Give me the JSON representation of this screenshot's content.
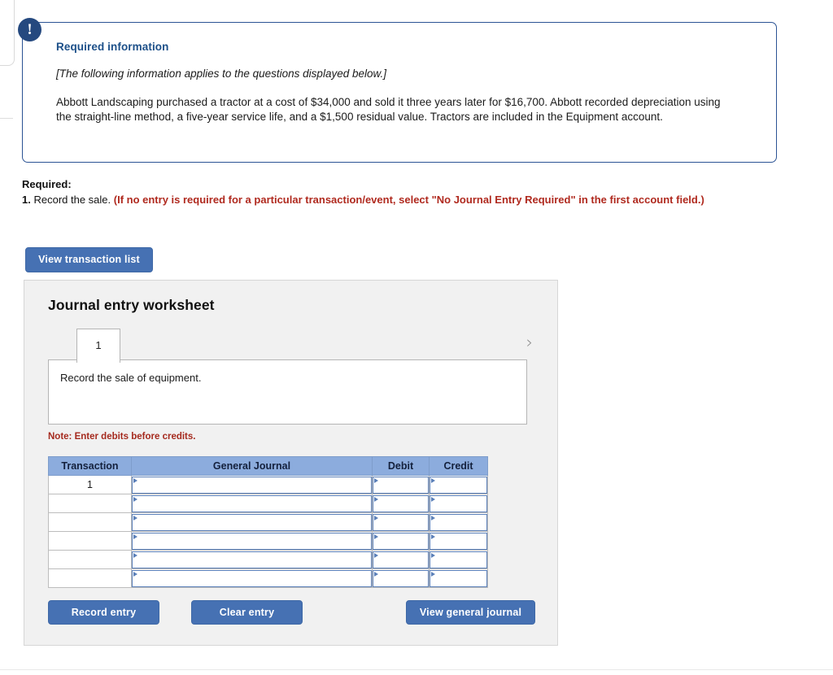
{
  "alert": {
    "icon": "exclamation-icon",
    "title": "Required information",
    "italic_note": "[The following information applies to the questions displayed below.]",
    "body": "Abbott Landscaping purchased a tractor at a cost of $34,000 and sold it three years later for $16,700. Abbott recorded depreciation using the straight-line method, a five-year service life, and a $1,500 residual value. Tractors are included in the Equipment account."
  },
  "required": {
    "label": "Required:",
    "item_number": "1.",
    "item_text": "Record the sale.",
    "emphasis": "(If no entry is required for a particular transaction/event, select \"No Journal Entry Required\" in the first account field.)"
  },
  "toolbar": {
    "view_transaction_list": "View transaction list"
  },
  "worksheet": {
    "title": "Journal entry worksheet",
    "prev_icon": "chevron-left-icon",
    "next_icon": "chevron-right-icon",
    "tabs": [
      {
        "label": "1",
        "active": true
      }
    ],
    "description": "Record the sale of equipment.",
    "note": "Note: Enter debits before credits.",
    "table": {
      "headers": [
        "Transaction",
        "General Journal",
        "Debit",
        "Credit"
      ],
      "rows": [
        {
          "transaction": "1",
          "general_journal": "",
          "debit": "",
          "credit": ""
        },
        {
          "transaction": "",
          "general_journal": "",
          "debit": "",
          "credit": ""
        },
        {
          "transaction": "",
          "general_journal": "",
          "debit": "",
          "credit": ""
        },
        {
          "transaction": "",
          "general_journal": "",
          "debit": "",
          "credit": ""
        },
        {
          "transaction": "",
          "general_journal": "",
          "debit": "",
          "credit": ""
        },
        {
          "transaction": "",
          "general_journal": "",
          "debit": "",
          "credit": ""
        }
      ]
    },
    "actions": {
      "record_entry": "Record entry",
      "clear_entry": "Clear entry",
      "view_general_journal": "View general journal"
    }
  },
  "colors": {
    "accent_blue": "#4671b3",
    "header_blue": "#8cacdd",
    "callout_border": "#2b5394",
    "badge_navy": "#25497f",
    "title_blue": "#1d5089",
    "alert_red": "#b02a1f",
    "note_red": "#a52a1e",
    "panel_bg": "#f1f1f1"
  }
}
